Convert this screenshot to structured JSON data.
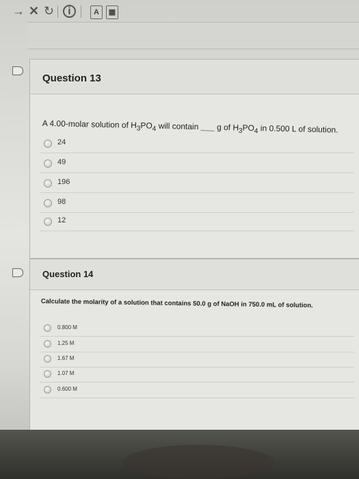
{
  "toolbar": {
    "back_icon": "arrow-right-icon",
    "close_icon": "close-icon",
    "refresh_icon": "refresh-icon",
    "info_icon": "info-icon"
  },
  "questions": [
    {
      "title": "Question 13",
      "text_prefix": "A 4.00-molar solution of H",
      "sub1": "3",
      "text_mid1": "PO",
      "sub2": "4",
      "text_mid2": " will contain ",
      "blank": "____",
      "text_mid3": " g of H",
      "sub3": "3",
      "text_mid4": "PO",
      "sub4": "4",
      "text_suffix": " in 0.500 L of solution.",
      "options": [
        "24",
        "49",
        "196",
        "98",
        "12"
      ]
    },
    {
      "title": "Question 14",
      "text": "Calculate the molarity of a solution that contains 50.0 g of NaOH in 750.0 mL of solution.",
      "options": [
        "0.800 M",
        "1.25 M",
        "1.67 M",
        "1.07 M",
        "0.600 M"
      ]
    }
  ]
}
